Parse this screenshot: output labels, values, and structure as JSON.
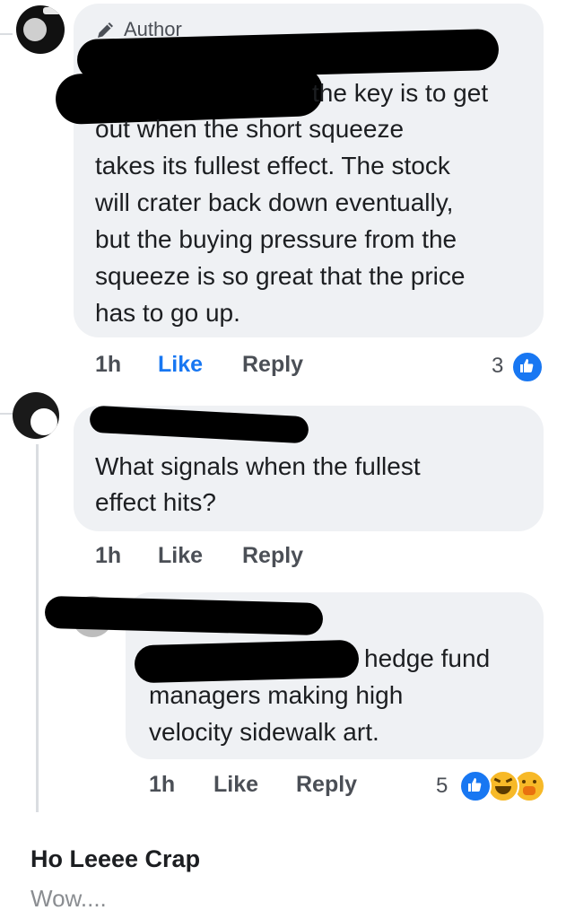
{
  "comments": [
    {
      "badge": "Author",
      "body_visible": "the key is to get",
      "body_lines": [
        "out when the short squeeze",
        "takes its fullest effect. The stock",
        "will crater back down eventually,",
        "but the buying pressure from the",
        "squeeze is so great that the price",
        "has to go up."
      ],
      "time": "1h",
      "like": "Like",
      "reply": "Reply",
      "reaction_count": "3",
      "reactions": [
        "like-icon"
      ]
    },
    {
      "body_lines": [
        "What signals when the fullest",
        "effect hits?"
      ],
      "time": "1h",
      "like": "Like",
      "reply": "Reply"
    },
    {
      "body_first": "hedge fund",
      "body_lines": [
        "managers making high",
        "velocity sidewalk art."
      ],
      "time": "1h",
      "like": "Like",
      "reply": "Reply",
      "reaction_count": "5",
      "reactions": [
        "like-icon",
        "haha-icon",
        "care-icon"
      ]
    }
  ],
  "post": {
    "title": "Ho Leeee Crap",
    "subtitle": "Wow...."
  },
  "colors": {
    "bubble": "#eff1f4",
    "like_blue": "#1877f2",
    "meta_gray": "#4b4f56",
    "haha_yellow": "#f7b928"
  }
}
